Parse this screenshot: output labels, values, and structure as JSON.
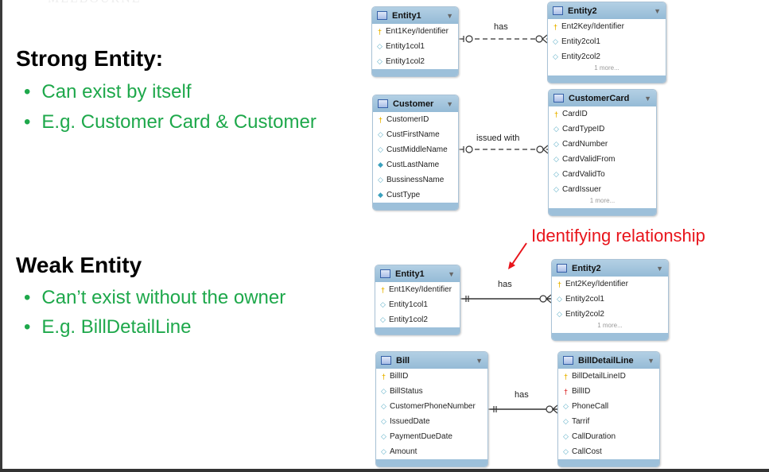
{
  "watermark": "MELBOURNE",
  "strong": {
    "heading": "Strong Entity:",
    "bullets": [
      "Can exist by itself",
      "E.g. Customer Card & Customer"
    ]
  },
  "weak": {
    "heading": "Weak Entity",
    "bullets": [
      "Can’t exist without the owner",
      "E.g. BillDetailLine"
    ]
  },
  "annotation": "Identifying relationship",
  "colors": {
    "bullet": "#1ea84b",
    "annotation": "#e8141b",
    "table_header": "#9dc0da"
  },
  "tables": [
    {
      "name": "Entity1",
      "rows": [
        [
          "key",
          "Ent1Key/Identifier"
        ],
        [
          "attr",
          "Entity1col1"
        ],
        [
          "attr",
          "Entity1col2"
        ]
      ]
    },
    {
      "name": "Entity2",
      "rows": [
        [
          "key",
          "Ent2Key/Identifier"
        ],
        [
          "attr",
          "Entity2col1"
        ],
        [
          "attr",
          "Entity2col2"
        ]
      ],
      "more": "1 more..."
    },
    {
      "name": "Customer",
      "rows": [
        [
          "key",
          "CustomerID"
        ],
        [
          "attr",
          "CustFirstName"
        ],
        [
          "attr",
          "CustMiddleName"
        ],
        [
          "attrf",
          "CustLastName"
        ],
        [
          "attr",
          "BussinessName"
        ],
        [
          "attrf",
          "CustType"
        ]
      ]
    },
    {
      "name": "CustomerCard",
      "rows": [
        [
          "key",
          "CardID"
        ],
        [
          "attr",
          "CardTypeID"
        ],
        [
          "attr",
          "CardNumber"
        ],
        [
          "attr",
          "CardValidFrom"
        ],
        [
          "attr",
          "CardValidTo"
        ],
        [
          "attr",
          "CardIssuer"
        ]
      ],
      "more": "1 more..."
    },
    {
      "name": "Entity1",
      "rows": [
        [
          "key",
          "Ent1Key/Identifier"
        ],
        [
          "attr",
          "Entity1col1"
        ],
        [
          "attr",
          "Entity1col2"
        ]
      ]
    },
    {
      "name": "Entity2",
      "rows": [
        [
          "key",
          "Ent2Key/Identifier"
        ],
        [
          "attr",
          "Entity2col1"
        ],
        [
          "attr",
          "Entity2col2"
        ]
      ],
      "more": "1 more..."
    },
    {
      "name": "Bill",
      "rows": [
        [
          "key",
          "BillID"
        ],
        [
          "attr",
          "BillStatus"
        ],
        [
          "attr",
          "CustomerPhoneNumber"
        ],
        [
          "attr",
          "IssuedDate"
        ],
        [
          "attr",
          "PaymentDueDate"
        ],
        [
          "attr",
          "Amount"
        ]
      ]
    },
    {
      "name": "BillDetailLine",
      "rows": [
        [
          "key",
          "BillDetailLineID"
        ],
        [
          "fk",
          "BillID"
        ],
        [
          "attr",
          "PhoneCall"
        ],
        [
          "attr",
          "Tarrif"
        ],
        [
          "attr",
          "CallDuration"
        ],
        [
          "attr",
          "CallCost"
        ]
      ]
    }
  ],
  "relationships": [
    {
      "label": "has",
      "style": "dashed"
    },
    {
      "label": "issued with",
      "style": "dashed"
    },
    {
      "label": "has",
      "style": "identifying"
    },
    {
      "label": "has",
      "style": "identifying"
    }
  ]
}
